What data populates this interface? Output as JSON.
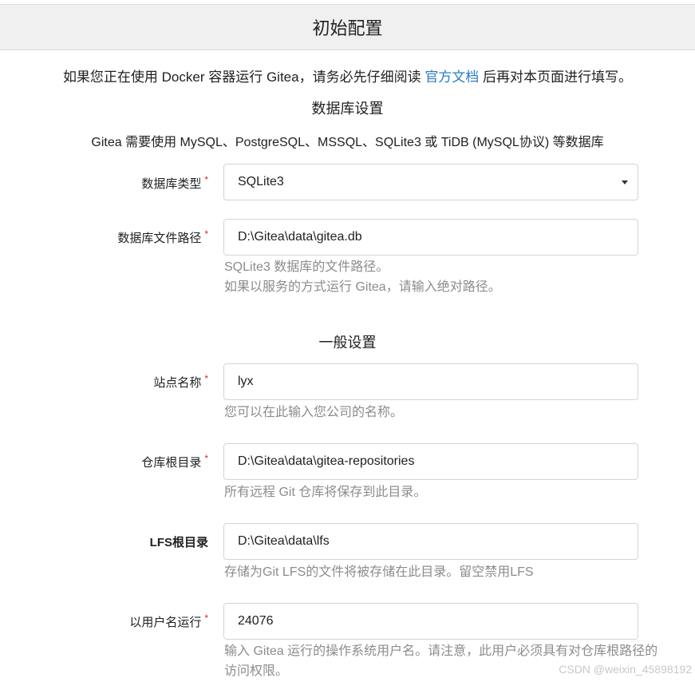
{
  "header": {
    "title": "初始配置"
  },
  "notice": {
    "before": "如果您正在使用 Docker 容器运行 Gitea，请务必先仔细阅读 ",
    "link": "官方文档",
    "after": " 后再对本页面进行填写。"
  },
  "database": {
    "title": "数据库设置",
    "note": "Gitea 需要使用 MySQL、PostgreSQL、MSSQL、SQLite3 或 TiDB (MySQL协议) 等数据库",
    "type_label": "数据库类型",
    "type_value": "SQLite3",
    "path_label": "数据库文件路径",
    "path_value": "D:\\Gitea\\data\\gitea.db",
    "path_help_1": "SQLite3 数据库的文件路径。",
    "path_help_2": "如果以服务的方式运行 Gitea，请输入绝对路径。"
  },
  "general": {
    "title": "一般设置",
    "site_label": "站点名称",
    "site_value": "lyx",
    "site_help": "您可以在此输入您公司的名称。",
    "repo_label": "仓库根目录",
    "repo_value": "D:\\Gitea\\data\\gitea-repositories",
    "repo_help": "所有远程 Git 仓库将保存到此目录。",
    "lfs_label": "LFS根目录",
    "lfs_value": "D:\\Gitea\\data\\lfs",
    "lfs_help": "存储为Git LFS的文件将被存储在此目录。留空禁用LFS",
    "user_label": "以用户名运行",
    "user_value": "24076",
    "user_help_1": "输入 Gitea 运行的操作系统用户名。请注意，此用户必须具有对仓库根路径的",
    "user_help_2": "访问权限。"
  },
  "required_mark": "*",
  "watermark": "CSDN @weixin_45898192"
}
